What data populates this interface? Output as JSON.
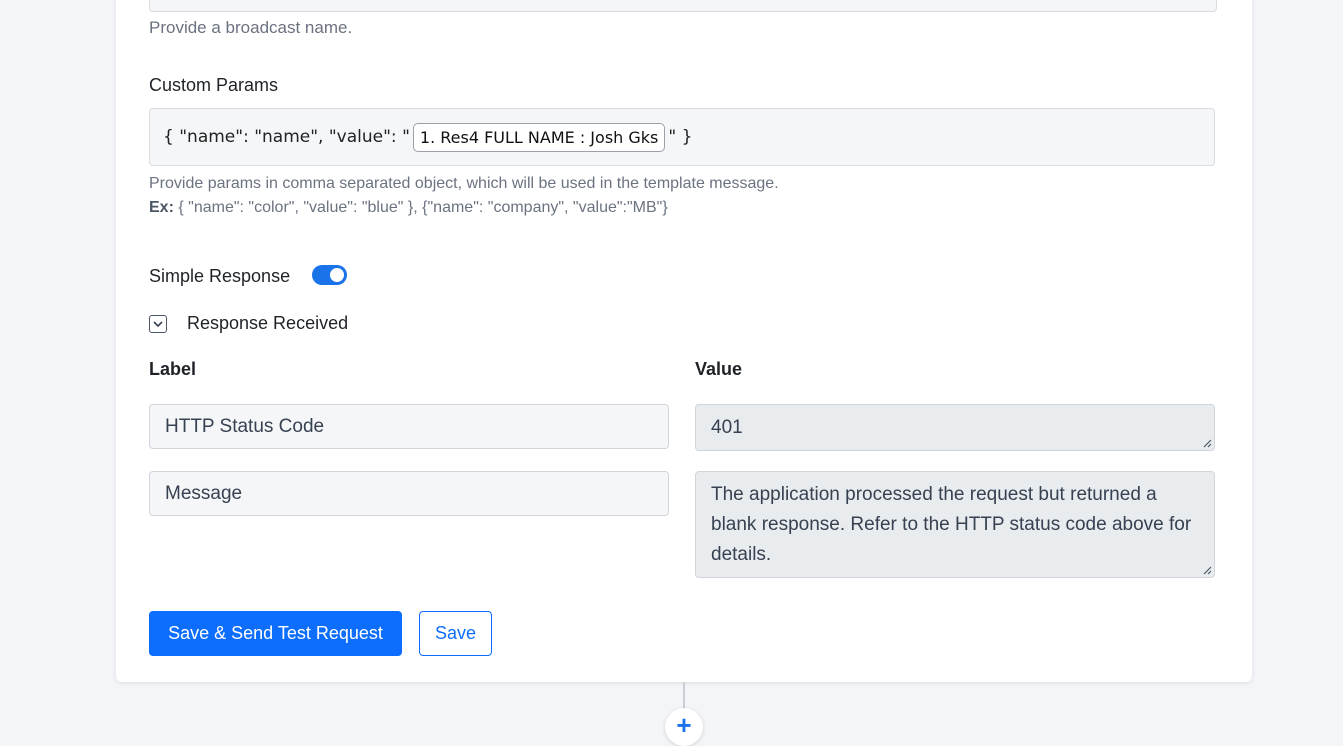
{
  "broadcast": {
    "help": "Provide a broadcast name."
  },
  "custom_params": {
    "label": "Custom Params",
    "prefix": "{ \"name\": \"name\", \"value\": \"",
    "token": "1. Res4 FULL NAME : Josh Gks",
    "suffix": "\" }",
    "help": "Provide params in comma separated object, which will be used in the template message.",
    "example_label": "Ex:",
    "example_value": "{ \"name\": \"color\", \"value\": \"blue\" }, {\"name\": \"company\", \"value\":\"MB\"}"
  },
  "simple_response": {
    "label": "Simple Response",
    "enabled": true
  },
  "response_received": {
    "label": "Response Received",
    "expanded": true,
    "columns": {
      "label": "Label",
      "value": "Value"
    },
    "rows": [
      {
        "label": "HTTP Status Code",
        "value": "401"
      },
      {
        "label": "Message",
        "value": "The application processed the request but returned a blank response.  Refer to the HTTP status code above for details."
      }
    ]
  },
  "buttons": {
    "save_send": "Save & Send Test Request",
    "save": "Save"
  },
  "flow": {
    "add_symbol": "+"
  },
  "colors": {
    "primary": "#0d6efd",
    "toggle": "#1a73e8",
    "background": "#f3f5f8"
  }
}
